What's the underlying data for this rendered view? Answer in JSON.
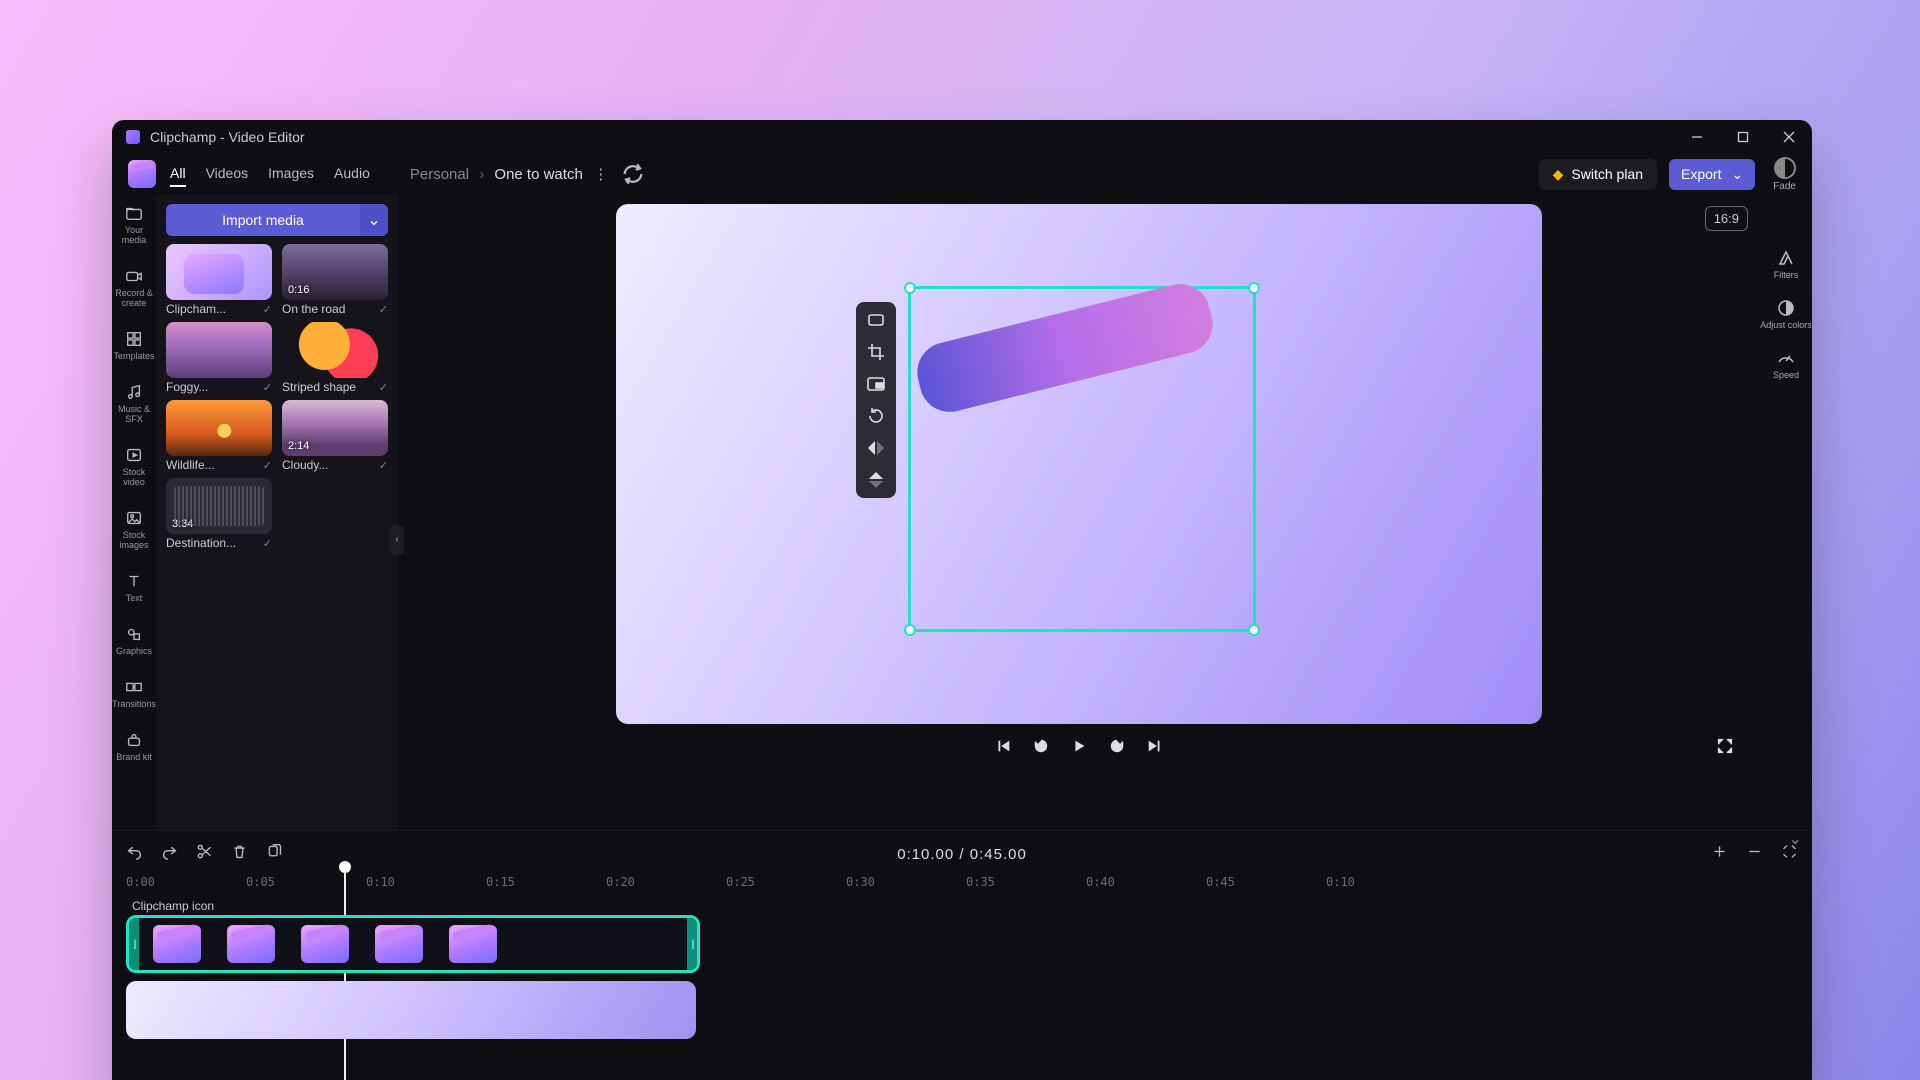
{
  "window": {
    "title": "Clipchamp - Video Editor"
  },
  "header": {
    "tabs": [
      "All",
      "Videos",
      "Images",
      "Audio"
    ],
    "active_tab": 0,
    "breadcrumb_root": "Personal",
    "breadcrumb_name": "One to watch",
    "switch_plan": "Switch plan",
    "export": "Export",
    "fade_label": "Fade",
    "aspect_ratio": "16:9"
  },
  "siderail": [
    {
      "label": "Your media",
      "icon": "folder"
    },
    {
      "label": "Record & create",
      "icon": "camera"
    },
    {
      "label": "Templates",
      "icon": "templates"
    },
    {
      "label": "Music & SFX",
      "icon": "music"
    },
    {
      "label": "Stock video",
      "icon": "stockvideo"
    },
    {
      "label": "Stock images",
      "icon": "stockimage"
    },
    {
      "label": "Text",
      "icon": "text"
    },
    {
      "label": "Graphics",
      "icon": "graphics"
    },
    {
      "label": "Transitions",
      "icon": "transitions"
    },
    {
      "label": "Brand kit",
      "icon": "brandkit"
    }
  ],
  "import_button": "Import media",
  "media": [
    {
      "name": "Clipcham...",
      "dur": "",
      "cls": "t-logo"
    },
    {
      "name": "On the road",
      "dur": "0:16",
      "cls": "t-road"
    },
    {
      "name": "Foggy...",
      "dur": "",
      "cls": "t-foggy"
    },
    {
      "name": "Striped shape",
      "dur": "",
      "cls": "t-stripe"
    },
    {
      "name": "Wildlife...",
      "dur": "",
      "cls": "t-wild"
    },
    {
      "name": "Cloudy...",
      "dur": "2:14",
      "cls": "t-cloudy"
    },
    {
      "name": "Destination...",
      "dur": "3:34",
      "cls": "t-audio"
    }
  ],
  "proprail": [
    {
      "label": "Filters"
    },
    {
      "label": "Adjust colors"
    },
    {
      "label": "Speed"
    }
  ],
  "time": {
    "current": "0:10.00",
    "total": "0:45.00",
    "sep": " / "
  },
  "ruler": [
    "0:00",
    "0:05",
    "0:10",
    "0:15",
    "0:20",
    "0:25",
    "0:30",
    "0:35",
    "0:40",
    "0:45",
    "0:10"
  ],
  "timeline_clip_label": "Clipchamp icon"
}
